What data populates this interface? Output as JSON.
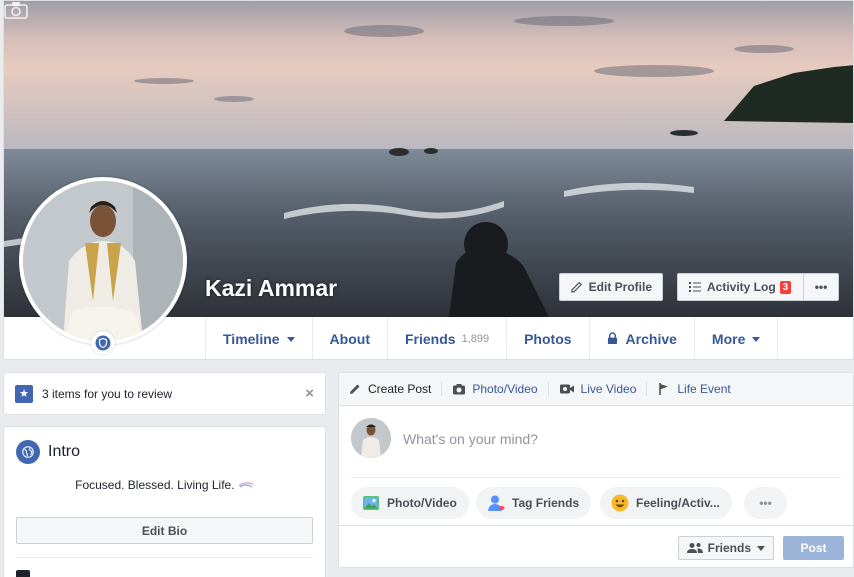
{
  "profile": {
    "name": "Kazi Ammar",
    "edit_profile_label": "Edit Profile",
    "activity_log_label": "Activity Log",
    "activity_log_count": "3",
    "more_label": "•••"
  },
  "nav": {
    "items": [
      {
        "label": "Timeline",
        "has_caret": true
      },
      {
        "label": "About"
      },
      {
        "label": "Friends",
        "count": "1,899"
      },
      {
        "label": "Photos"
      },
      {
        "label": "Archive",
        "icon": "lock-icon"
      },
      {
        "label": "More",
        "has_caret": true
      }
    ]
  },
  "review": {
    "text": "3 items for you to review",
    "close": "×"
  },
  "intro": {
    "title": "Intro",
    "bio": "Focused. Blessed. Living Life.",
    "edit_bio_label": "Edit Bio"
  },
  "composer": {
    "tabs": [
      {
        "label": "Create Post",
        "icon": "pencil-icon"
      },
      {
        "label": "Photo/Video",
        "icon": "camera-icon"
      },
      {
        "label": "Live Video",
        "icon": "video-icon"
      },
      {
        "label": "Life Event",
        "icon": "flag-icon"
      }
    ],
    "placeholder": "What's on your mind?",
    "actions": [
      {
        "label": "Photo/Video",
        "icon": "photo-icon"
      },
      {
        "label": "Tag Friends",
        "icon": "tag-friends-icon"
      },
      {
        "label": "Feeling/Activ...",
        "icon": "smiley-icon"
      },
      {
        "label": "•••",
        "icon": "more-icon"
      }
    ],
    "audience_label": "Friends",
    "post_label": "Post"
  },
  "colors": {
    "link_blue": "#365899",
    "brand_blue": "#4267b2",
    "badge_red": "#fa3e3e",
    "post_disabled": "#9cb4d8"
  }
}
